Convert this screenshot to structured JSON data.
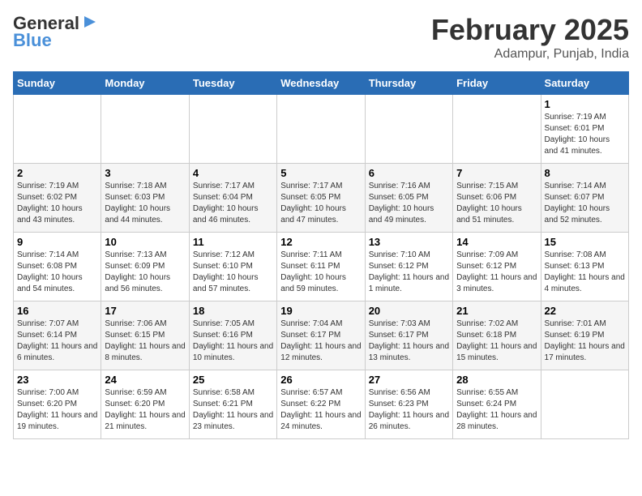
{
  "header": {
    "logo_line1": "General",
    "logo_line2": "Blue",
    "title": "February 2025",
    "subtitle": "Adampur, Punjab, India"
  },
  "days_of_week": [
    "Sunday",
    "Monday",
    "Tuesday",
    "Wednesday",
    "Thursday",
    "Friday",
    "Saturday"
  ],
  "weeks": [
    [
      {
        "day": "",
        "info": ""
      },
      {
        "day": "",
        "info": ""
      },
      {
        "day": "",
        "info": ""
      },
      {
        "day": "",
        "info": ""
      },
      {
        "day": "",
        "info": ""
      },
      {
        "day": "",
        "info": ""
      },
      {
        "day": "1",
        "info": "Sunrise: 7:19 AM\nSunset: 6:01 PM\nDaylight: 10 hours and 41 minutes."
      }
    ],
    [
      {
        "day": "2",
        "info": "Sunrise: 7:19 AM\nSunset: 6:02 PM\nDaylight: 10 hours and 43 minutes."
      },
      {
        "day": "3",
        "info": "Sunrise: 7:18 AM\nSunset: 6:03 PM\nDaylight: 10 hours and 44 minutes."
      },
      {
        "day": "4",
        "info": "Sunrise: 7:17 AM\nSunset: 6:04 PM\nDaylight: 10 hours and 46 minutes."
      },
      {
        "day": "5",
        "info": "Sunrise: 7:17 AM\nSunset: 6:05 PM\nDaylight: 10 hours and 47 minutes."
      },
      {
        "day": "6",
        "info": "Sunrise: 7:16 AM\nSunset: 6:05 PM\nDaylight: 10 hours and 49 minutes."
      },
      {
        "day": "7",
        "info": "Sunrise: 7:15 AM\nSunset: 6:06 PM\nDaylight: 10 hours and 51 minutes."
      },
      {
        "day": "8",
        "info": "Sunrise: 7:14 AM\nSunset: 6:07 PM\nDaylight: 10 hours and 52 minutes."
      }
    ],
    [
      {
        "day": "9",
        "info": "Sunrise: 7:14 AM\nSunset: 6:08 PM\nDaylight: 10 hours and 54 minutes."
      },
      {
        "day": "10",
        "info": "Sunrise: 7:13 AM\nSunset: 6:09 PM\nDaylight: 10 hours and 56 minutes."
      },
      {
        "day": "11",
        "info": "Sunrise: 7:12 AM\nSunset: 6:10 PM\nDaylight: 10 hours and 57 minutes."
      },
      {
        "day": "12",
        "info": "Sunrise: 7:11 AM\nSunset: 6:11 PM\nDaylight: 10 hours and 59 minutes."
      },
      {
        "day": "13",
        "info": "Sunrise: 7:10 AM\nSunset: 6:12 PM\nDaylight: 11 hours and 1 minute."
      },
      {
        "day": "14",
        "info": "Sunrise: 7:09 AM\nSunset: 6:12 PM\nDaylight: 11 hours and 3 minutes."
      },
      {
        "day": "15",
        "info": "Sunrise: 7:08 AM\nSunset: 6:13 PM\nDaylight: 11 hours and 4 minutes."
      }
    ],
    [
      {
        "day": "16",
        "info": "Sunrise: 7:07 AM\nSunset: 6:14 PM\nDaylight: 11 hours and 6 minutes."
      },
      {
        "day": "17",
        "info": "Sunrise: 7:06 AM\nSunset: 6:15 PM\nDaylight: 11 hours and 8 minutes."
      },
      {
        "day": "18",
        "info": "Sunrise: 7:05 AM\nSunset: 6:16 PM\nDaylight: 11 hours and 10 minutes."
      },
      {
        "day": "19",
        "info": "Sunrise: 7:04 AM\nSunset: 6:17 PM\nDaylight: 11 hours and 12 minutes."
      },
      {
        "day": "20",
        "info": "Sunrise: 7:03 AM\nSunset: 6:17 PM\nDaylight: 11 hours and 13 minutes."
      },
      {
        "day": "21",
        "info": "Sunrise: 7:02 AM\nSunset: 6:18 PM\nDaylight: 11 hours and 15 minutes."
      },
      {
        "day": "22",
        "info": "Sunrise: 7:01 AM\nSunset: 6:19 PM\nDaylight: 11 hours and 17 minutes."
      }
    ],
    [
      {
        "day": "23",
        "info": "Sunrise: 7:00 AM\nSunset: 6:20 PM\nDaylight: 11 hours and 19 minutes."
      },
      {
        "day": "24",
        "info": "Sunrise: 6:59 AM\nSunset: 6:20 PM\nDaylight: 11 hours and 21 minutes."
      },
      {
        "day": "25",
        "info": "Sunrise: 6:58 AM\nSunset: 6:21 PM\nDaylight: 11 hours and 23 minutes."
      },
      {
        "day": "26",
        "info": "Sunrise: 6:57 AM\nSunset: 6:22 PM\nDaylight: 11 hours and 24 minutes."
      },
      {
        "day": "27",
        "info": "Sunrise: 6:56 AM\nSunset: 6:23 PM\nDaylight: 11 hours and 26 minutes."
      },
      {
        "day": "28",
        "info": "Sunrise: 6:55 AM\nSunset: 6:24 PM\nDaylight: 11 hours and 28 minutes."
      },
      {
        "day": "",
        "info": ""
      }
    ]
  ]
}
